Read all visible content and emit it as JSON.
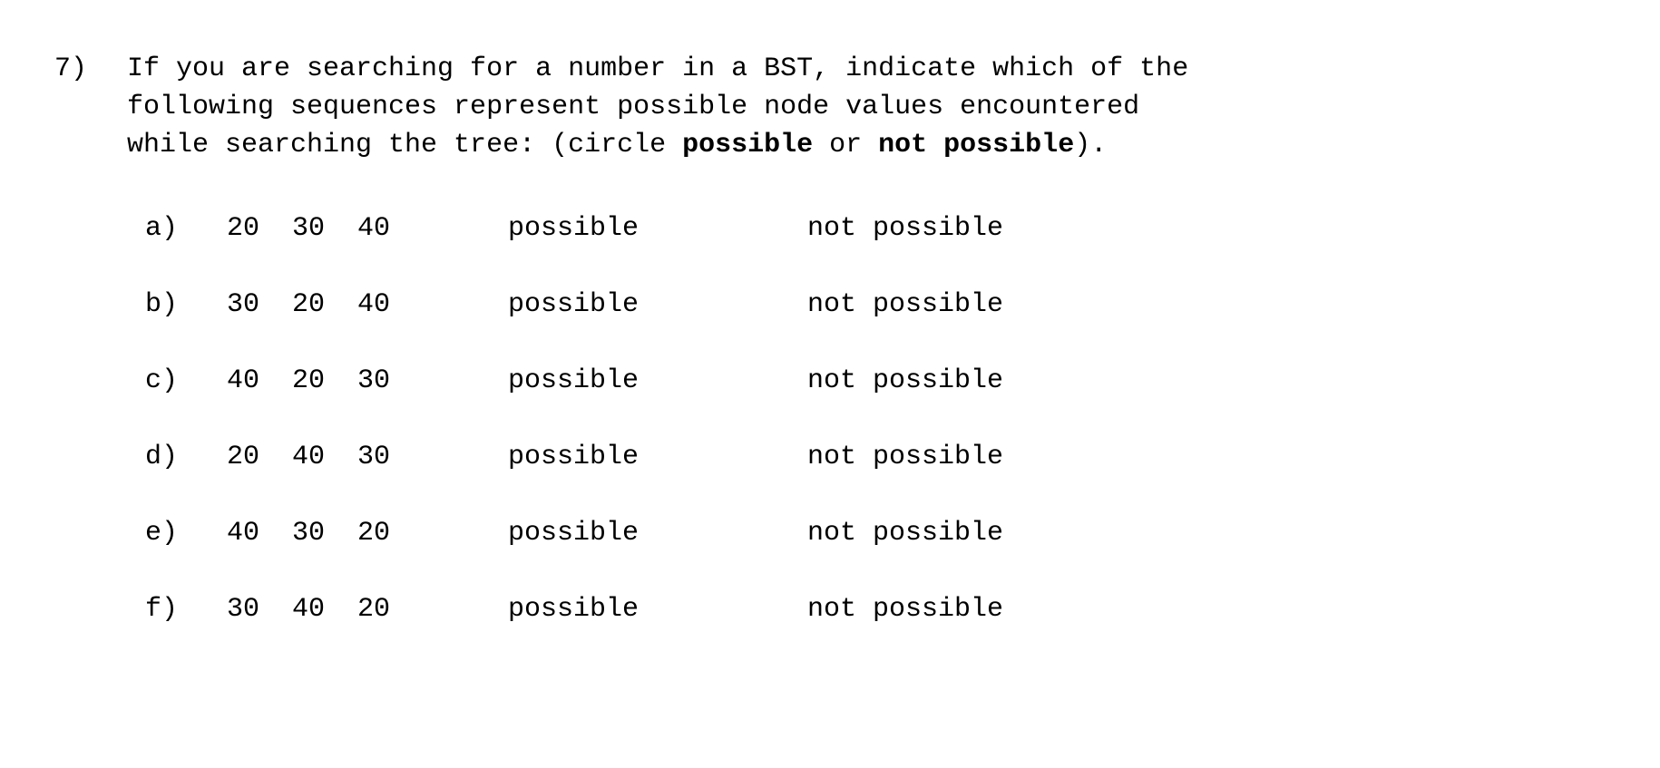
{
  "question_number": "7)",
  "intro": {
    "line1a": "If you are searching for a number in a BST, indicate which of the",
    "line2a": "following sequences represent possible node values encountered",
    "line3a": "while searching the tree: (circle ",
    "bold1": "possible",
    "mid": " or ",
    "bold2": "not possible",
    "tail": ")."
  },
  "labels": {
    "possible": "possible",
    "not_possible": "not possible"
  },
  "options": [
    {
      "label": "a)",
      "seq": "20  30  40"
    },
    {
      "label": "b)",
      "seq": "30  20  40"
    },
    {
      "label": "c)",
      "seq": "40  20  30"
    },
    {
      "label": "d)",
      "seq": "20  40  30"
    },
    {
      "label": "e)",
      "seq": "40  30  20"
    },
    {
      "label": "f)",
      "seq": "30  40  20"
    }
  ]
}
